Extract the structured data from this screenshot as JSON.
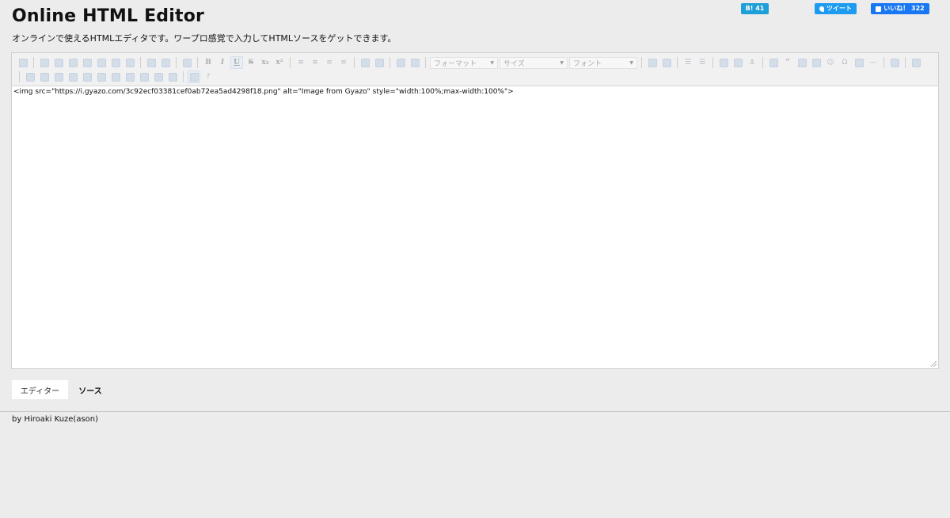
{
  "header": {
    "title": "Online HTML Editor",
    "subtitle": "オンラインで使えるHTMLエディタです。ワープロ感覚で入力してHTMLソースをゲットできます。"
  },
  "social": {
    "hatena_label": "B! 41",
    "tweet_label": "ツイート",
    "like_label": "いいね！ 322"
  },
  "toolbar": {
    "format_placeholder": "フォーマット",
    "size_placeholder": "サイズ",
    "font_placeholder": "フォント",
    "buttons_row1": [
      "new-page",
      "cut",
      "copy",
      "paste",
      "paste-text",
      "paste-word",
      "print",
      "spellcheck",
      "undo",
      "redo",
      "find",
      "bold",
      "italic",
      "underline",
      "strike",
      "subscript",
      "superscript",
      "align-left",
      "align-center",
      "align-right",
      "justify",
      "outdent",
      "indent",
      "text-color",
      "bg-color",
      "format",
      "size",
      "font",
      "ltr",
      "rtl",
      "numbered-list",
      "bulleted-list",
      "link",
      "unlink",
      "anchor",
      "div",
      "blockquote",
      "select-all",
      "image",
      "smiley",
      "special-char",
      "page-break",
      "horizontal-rule",
      "iframe",
      "show-blocks"
    ],
    "buttons_row2": [
      "form",
      "checkbox",
      "radio",
      "text-field",
      "textarea",
      "select",
      "button",
      "image-button",
      "hidden-field",
      "table",
      "hr",
      "maximize",
      "about"
    ]
  },
  "editor": {
    "content": "<img src=\"https://i.gyazo.com/3c92ecf03381cef0ab72ea5ad4298f18.png\" alt=\"Image from Gyazo\" style=\"width:100%;max-width:100%\">"
  },
  "tabs": {
    "editor_label": "エディター",
    "source_label": "ソース"
  },
  "footer": {
    "credit": "by Hiroaki Kuze(ason)"
  }
}
